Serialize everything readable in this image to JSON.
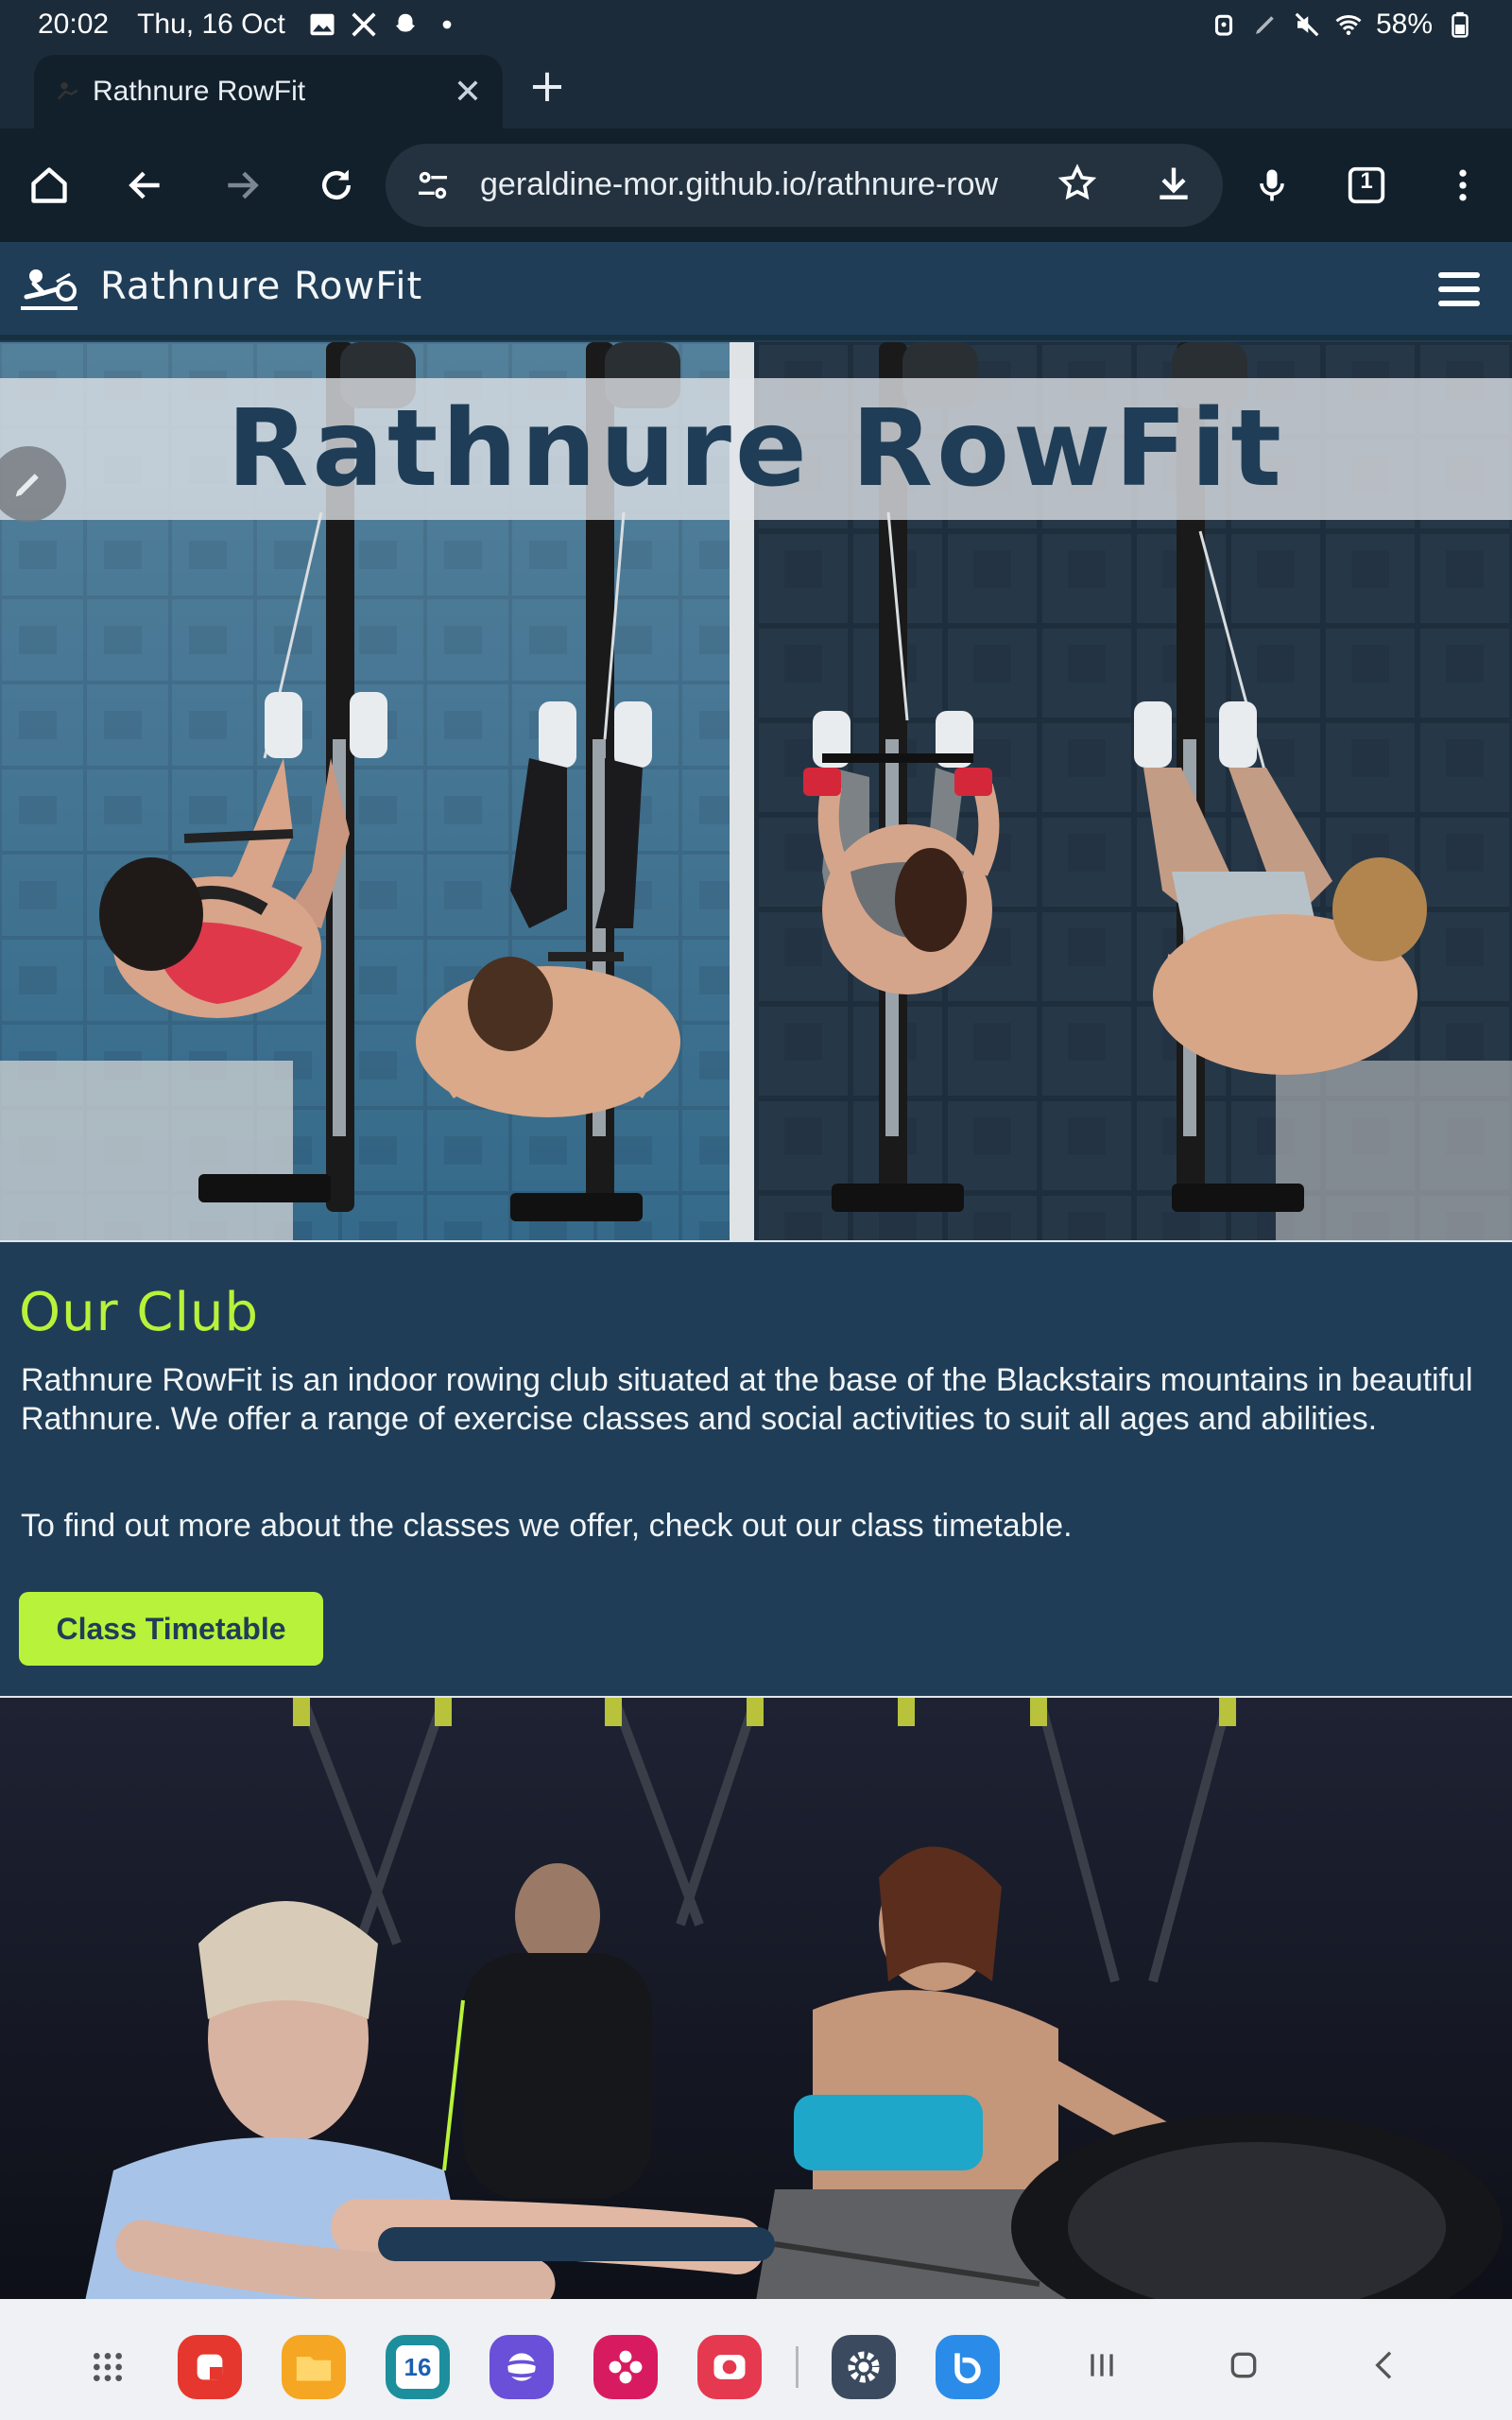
{
  "status_bar": {
    "time": "20:02",
    "date": "Thu, 16 Oct",
    "battery": "58%",
    "icons": [
      "gallery-icon",
      "tools-icon",
      "snapchat-icon",
      "dot-icon",
      "alarm-icon",
      "pen-icon",
      "mute-icon",
      "wifi-icon",
      "battery-icon"
    ]
  },
  "browser": {
    "tab_title": "Rathnure RowFit",
    "url": "geraldine-mor.github.io/rathnure-row",
    "tab_count": "1"
  },
  "site": {
    "brand": "Rathnure RowFit",
    "hero_title": "Rathnure RowFit",
    "club_heading": "Our Club",
    "club_text_1": "Rathnure RowFit is an indoor rowing club situated at the base of the Blackstairs mountains in beautiful Rathnure. We offer a range of exercise classes and social activities to suit all ages and abilities.",
    "club_text_2": "To find out more about the classes we offer, check out our class timetable.",
    "timetable_button": "Class Timetable",
    "colors": {
      "navy": "#1f3d57",
      "lime": "#b8f23a"
    }
  },
  "dock": {
    "calendar_day": "16",
    "apps": [
      "apps-grid-icon",
      "notes-app-icon",
      "files-app-icon",
      "calendar-app-icon",
      "internet-app-icon",
      "gallery-app-icon",
      "camera-app-icon",
      "settings-app-icon",
      "bixby-app-icon"
    ]
  }
}
